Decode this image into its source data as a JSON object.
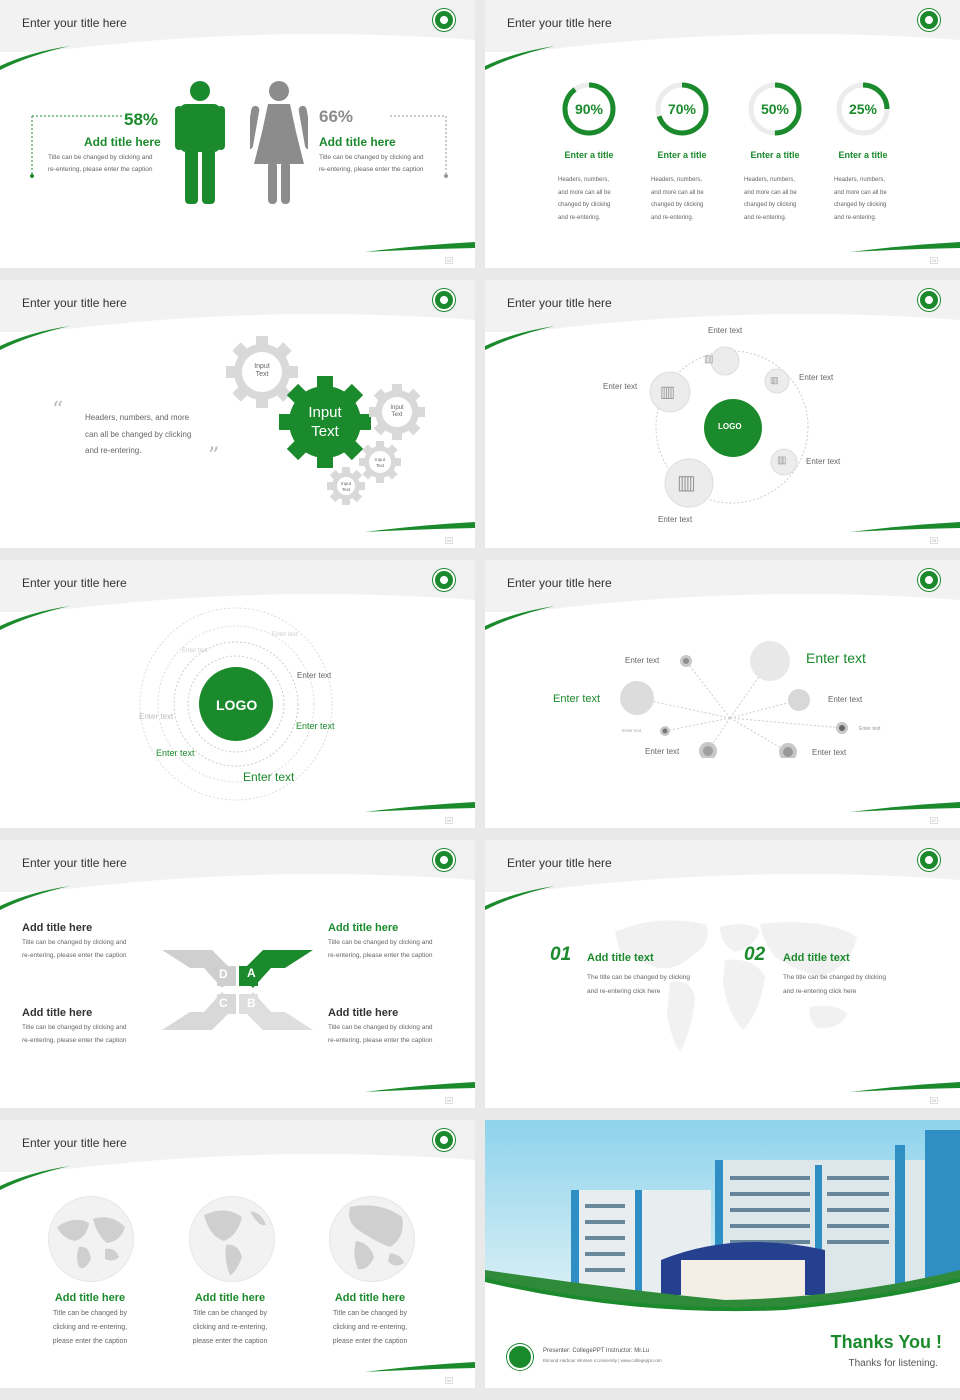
{
  "slides": {
    "s1": {
      "title": "Enter your title here",
      "page": "22",
      "left": {
        "pct": "58%",
        "title": "Add title here",
        "line1": "Title can be changed by clicking and",
        "line2": "re-entering, please enter the caption"
      },
      "right": {
        "pct": "66%",
        "title": "Add title here",
        "line1": "Title can be changed by clicking and",
        "line2": "re-entering, please enter the caption"
      },
      "male_value": 0.58,
      "female_value": 0.66
    },
    "s2": {
      "title": "Enter your title here",
      "page": "23",
      "rings": [
        {
          "pct": "90%",
          "value": 0.9,
          "title": "Enter a title",
          "l1": "Headers, numbers,",
          "l2": "and more can all be",
          "l3": "changed by clicking",
          "l4": "and re-entering."
        },
        {
          "pct": "70%",
          "value": 0.7,
          "title": "Enter a title",
          "l1": "Headers, numbers,",
          "l2": "and more can all be",
          "l3": "changed by clicking",
          "l4": "and re-entering."
        },
        {
          "pct": "50%",
          "value": 0.5,
          "title": "Enter a title",
          "l1": "Headers, numbers,",
          "l2": "and more can all be",
          "l3": "changed by clicking",
          "l4": "and re-entering."
        },
        {
          "pct": "25%",
          "value": 0.25,
          "title": "Enter a title",
          "l1": "Headers, numbers,",
          "l2": "and more can all be",
          "l3": "changed by clicking",
          "l4": "and re-entering."
        }
      ]
    },
    "s3": {
      "title": "Enter your title here",
      "page": "24",
      "quote_l1": "Headers, numbers, and more",
      "quote_l2": "can all be changed by clicking",
      "quote_l3": "and re-entering.",
      "gear_main_l1": "Input",
      "gear_main_l2": "Text",
      "gear_small_l1": "Input",
      "gear_small_l2": "Text"
    },
    "s4": {
      "title": "Enter your title here",
      "page": "25",
      "logo": "LOGO",
      "labels": [
        "Enter text",
        "Enter text",
        "Enter text",
        "Enter text",
        "Enter text"
      ]
    },
    "s5": {
      "title": "Enter your title here",
      "page": "26",
      "logo": "LOGO",
      "labels": [
        "Enter text",
        "Enter text",
        "Enter text",
        "Enter text",
        "Enter text",
        "Enter text",
        "Enter text",
        "Enter text"
      ]
    },
    "s6": {
      "title": "Enter your title here",
      "page": "27",
      "labels": [
        "Enter text",
        "Enter text",
        "Enter text",
        "Enter text",
        "Enter text",
        "Enter text",
        "Enter text",
        "Enter text",
        "Enter text"
      ]
    },
    "s7": {
      "title": "Enter your title here",
      "page": "28",
      "blocks": [
        {
          "title": "Add title here",
          "l1": "Title can be changed by clicking and",
          "l2": "re-entering, please enter the caption"
        },
        {
          "title": "Add title here",
          "l1": "Title can be changed by clicking and",
          "l2": "re-entering, please enter the caption"
        },
        {
          "title": "Add title here",
          "l1": "Title can be changed by clicking and",
          "l2": "re-entering, please enter the caption"
        },
        {
          "title": "Add title here",
          "l1": "Title can be changed by clicking and",
          "l2": "re-entering, please enter the caption"
        }
      ],
      "letters": [
        "A",
        "B",
        "C",
        "D"
      ]
    },
    "s8": {
      "title": "Enter your title here",
      "page": "29",
      "items": [
        {
          "num": "01",
          "title": "Add title text",
          "l1": "The title can be changed by clicking",
          "l2": "and re-entering click here"
        },
        {
          "num": "02",
          "title": "Add title text",
          "l1": "The title can be changed by clicking",
          "l2": "and re-entering click here"
        }
      ]
    },
    "s9": {
      "title": "Enter your title here",
      "page": "30",
      "items": [
        {
          "title": "Add title here",
          "l1": "Title can be changed by",
          "l2": "clicking and re-entering,",
          "l3": "please enter the caption"
        },
        {
          "title": "Add title here",
          "l1": "Title can be changed by",
          "l2": "clicking and re-entering,",
          "l3": "please enter the caption"
        },
        {
          "title": "Add title here",
          "l1": "Title can be changed by",
          "l2": "clicking and re-entering,",
          "l3": "please enter the caption"
        }
      ]
    },
    "s10": {
      "presenter": "Presenter: CollegePPT   Instructor: Mr.Lu",
      "university": "Eimond Harbour Women s University  |  www.collegeppt.com",
      "thanks": "Thanks You !",
      "thanks_sub": "Thanks for listening."
    }
  },
  "colors": {
    "accent": "#1b8a2c",
    "grey": "#9a9a9a",
    "light": "#f2f2f2"
  }
}
